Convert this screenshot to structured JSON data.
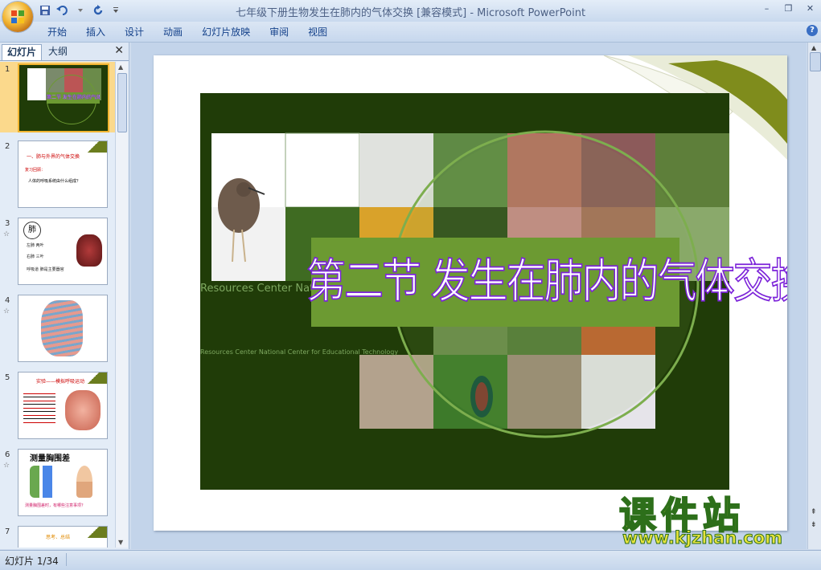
{
  "window": {
    "title": "七年级下册生物发生在肺内的气体交换 [兼容模式] - Microsoft PowerPoint",
    "controls": [
      "–",
      "❐",
      "✕"
    ]
  },
  "qat": {
    "save_icon": "save-icon",
    "undo_icon": "undo-icon",
    "redo_icon": "repeat-icon",
    "customize_icon": "chevron-down-icon"
  },
  "ribbon": {
    "tabs": [
      "开始",
      "插入",
      "设计",
      "动画",
      "幻灯片放映",
      "审阅",
      "视图"
    ],
    "help": "?"
  },
  "left_pane": {
    "tabs": [
      "幻灯片",
      "大纲"
    ],
    "close": "✕",
    "thumbnails": [
      {
        "num": "1",
        "anim": "",
        "selected": true,
        "title": "第二节 发生在肺内的气体交换"
      },
      {
        "num": "2",
        "anim": "",
        "selected": false,
        "title": "一、肺与外界的气体交换",
        "line1": "复习回顾：",
        "line2": "人体的呼吸系统由什么组成？"
      },
      {
        "num": "3",
        "anim": "☆",
        "selected": false,
        "title": "肺",
        "line1": "左肺 两叶",
        "line2": "右肺 三叶",
        "line3": "呼吸道 肺是主要器官"
      },
      {
        "num": "4",
        "anim": "☆",
        "selected": false,
        "title": ""
      },
      {
        "num": "5",
        "anim": "",
        "selected": false,
        "title": "实验——模拟呼吸运动"
      },
      {
        "num": "6",
        "anim": "☆",
        "selected": false,
        "title": "测量胸围差",
        "line1": "测量胸围差时，有哪些注意事项？"
      },
      {
        "num": "7",
        "anim": "",
        "selected": false,
        "title": "思考、总结"
      }
    ]
  },
  "slide": {
    "title": "第二节 发生在肺内的气体交换",
    "resources_line1": "Resources Center Natio",
    "resources_line2": "Resources Center National Center for Educational Technology"
  },
  "status": {
    "slide_counter": "幻灯片 1/34"
  },
  "watermark": {
    "site_cn": "课件站",
    "site_url": "www.kjzhan.com"
  },
  "colors": {
    "slide_bg_green": "#203c08",
    "title_band": "#6c9a32",
    "title_outline": "#7c23d9",
    "selection": "#f2b531"
  }
}
